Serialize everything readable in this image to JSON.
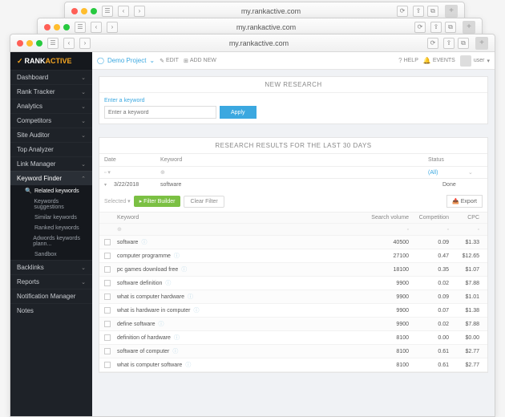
{
  "browser": {
    "url": "my.rankactive.com",
    "new_tab": "+"
  },
  "brand": {
    "prefix": "RANK",
    "suffix": "ACTIVE"
  },
  "nav": [
    {
      "label": "Dashboard",
      "chev": "⌄"
    },
    {
      "label": "Rank Tracker",
      "chev": "⌄"
    },
    {
      "label": "Analytics",
      "chev": "⌄"
    },
    {
      "label": "Competitors",
      "chev": "⌄"
    },
    {
      "label": "Site Auditor",
      "chev": "⌄"
    },
    {
      "label": "Top Analyzer",
      "chev": ""
    },
    {
      "label": "Link Manager",
      "chev": "⌄"
    },
    {
      "label": "Keyword Finder",
      "chev": "⌃",
      "active": true
    },
    {
      "label": "Backlinks",
      "chev": "⌄"
    },
    {
      "label": "Reports",
      "chev": "⌄"
    },
    {
      "label": "Notification Manager",
      "chev": ""
    },
    {
      "label": "Notes",
      "chev": ""
    }
  ],
  "subnav": [
    {
      "icon": "🔍",
      "label": "Related keywords",
      "active": true
    },
    {
      "icon": "",
      "label": "Keywords suggestions"
    },
    {
      "icon": "",
      "label": "Similar keywords"
    },
    {
      "icon": "",
      "label": "Ranked keywords"
    },
    {
      "icon": "",
      "label": "Adwords keywords plann..."
    },
    {
      "icon": "",
      "label": "Sandbox"
    }
  ],
  "topbar": {
    "project": "Demo Project",
    "edit": "EDIT",
    "add": "ADD NEW",
    "help": "HELP",
    "events": "EVENTS",
    "user": "user"
  },
  "new_research": {
    "title": "NEW RESEARCH",
    "label": "Enter a keyword",
    "placeholder": "Enter a keyword",
    "apply": "Apply"
  },
  "results": {
    "title": "RESEARCH RESULTS FOR THE LAST 30 DAYS",
    "cols": {
      "date": "Date",
      "keyword": "Keyword",
      "status": "Status"
    },
    "status_all": "(All)",
    "row": {
      "date": "3/22/2018",
      "keyword": "software",
      "status": "Done"
    },
    "toolbar": {
      "selected": "Selected ▾",
      "filter_builder": "▸ Filter Builder",
      "clear_filter": "Clear Filter",
      "export": "Export"
    },
    "kw_cols": {
      "keyword": "Keyword",
      "sv": "Search volume",
      "comp": "Competition",
      "cpc": "CPC"
    },
    "rows": [
      {
        "kw": "software",
        "sv": "40500",
        "comp": "0.09",
        "cpc": "$1.33"
      },
      {
        "kw": "computer programme",
        "sv": "27100",
        "comp": "0.47",
        "cpc": "$12.65"
      },
      {
        "kw": "pc games download free",
        "sv": "18100",
        "comp": "0.35",
        "cpc": "$1.07"
      },
      {
        "kw": "software definition",
        "sv": "9900",
        "comp": "0.02",
        "cpc": "$7.88"
      },
      {
        "kw": "what is computer hardware",
        "sv": "9900",
        "comp": "0.09",
        "cpc": "$1.01"
      },
      {
        "kw": "what is hardware in computer",
        "sv": "9900",
        "comp": "0.07",
        "cpc": "$1.38"
      },
      {
        "kw": "define software",
        "sv": "9900",
        "comp": "0.02",
        "cpc": "$7.88"
      },
      {
        "kw": "definition of hardware",
        "sv": "8100",
        "comp": "0.00",
        "cpc": "$0.00"
      },
      {
        "kw": "software of computer",
        "sv": "8100",
        "comp": "0.61",
        "cpc": "$2.77"
      },
      {
        "kw": "what is computer software",
        "sv": "8100",
        "comp": "0.61",
        "cpc": "$2.77"
      }
    ]
  }
}
